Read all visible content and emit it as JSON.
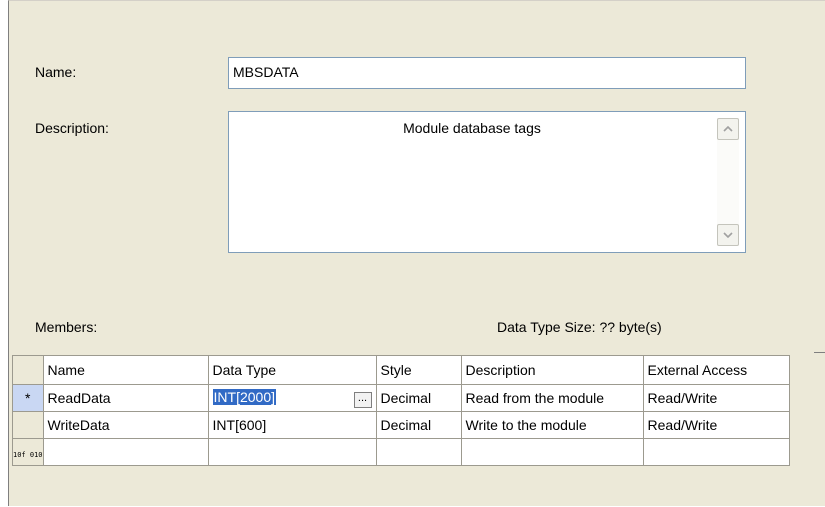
{
  "form": {
    "name_label": "Name:",
    "name_value": "MBSDATA",
    "description_label": "Description:",
    "description_value": "Module database tags",
    "members_label": "Members:",
    "data_type_size": "Data Type Size: ?? byte(s)"
  },
  "grid": {
    "columns": [
      "Name",
      "Data Type",
      "Style",
      "Description",
      "External Access"
    ],
    "rows": [
      {
        "marker": "*",
        "name": "ReadData",
        "data_type": "INT[2000]",
        "style": "Decimal",
        "description": "Read from the module",
        "external_access": "Read/Write"
      },
      {
        "marker": "",
        "name": "WriteData",
        "data_type": "INT[600]",
        "style": "Decimal",
        "description": "Write to the module",
        "external_access": "Read/Write"
      }
    ],
    "new_row_marker": "10f 010",
    "ellipsis": "..."
  },
  "icons": {
    "scroll_up": "chevron-up-icon",
    "scroll_down": "chevron-down-icon",
    "ellipsis": "ellipsis-icon"
  },
  "colors": {
    "dialog_bg": "#ece9d8",
    "selection": "#316ac5",
    "input_border": "#7f9db9"
  }
}
